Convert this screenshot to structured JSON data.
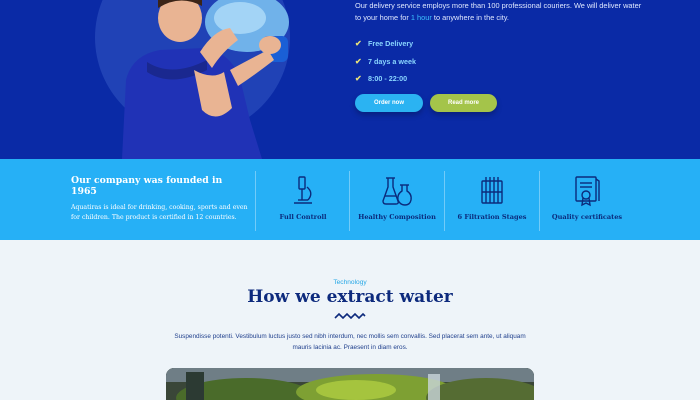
{
  "hero": {
    "description_line1": "Our delivery service employs more than 100 professional couriers. We will deliver water",
    "description_pre": "to your home for",
    "description_highlight": "1 hour",
    "description_post": "to anywhere in the city.",
    "features": [
      "Free Delivery",
      "7 days a week",
      "8:00 - 22:00"
    ],
    "order_label": "Order now",
    "read_label": "Read more"
  },
  "company": {
    "title": "Our company was founded in 1965",
    "text": "Aquatiras is ideal for drinking, cooking, sports and even for children. The product is certified in 12 countries."
  },
  "features": [
    {
      "label": "Full Controll",
      "icon": "microscope-icon"
    },
    {
      "label": "Healthy Composition",
      "icon": "flasks-icon"
    },
    {
      "label": "6 Filtration Stages",
      "icon": "filter-icon"
    },
    {
      "label": "Quality certificates",
      "icon": "certificate-icon"
    }
  ],
  "tech": {
    "eyebrow": "Technology",
    "title": "How we extract water",
    "description": "Suspendisse potenti. Vestibulum luctus justo sed nibh interdum, nec mollis sem convallis. Sed placerat sem ante, ut aliquam mauris lacinia ac. Praesent in diam eros."
  },
  "colors": {
    "hero_bg": "#0a2aa6",
    "strip_bg": "#26b0f6",
    "accent": "#2bb3f2",
    "green_button": "#a4c44a",
    "title_navy": "#0d2a7d"
  }
}
